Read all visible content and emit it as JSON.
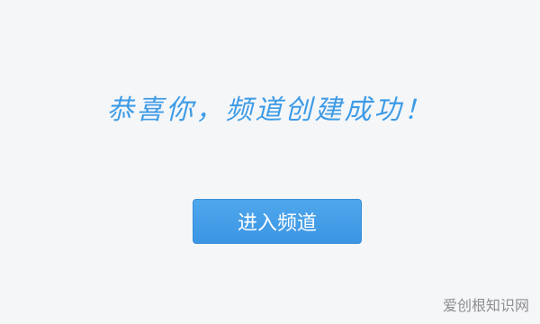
{
  "message": {
    "text": "恭喜你，频道创建成功！"
  },
  "actions": {
    "enter_label": "进入频道"
  },
  "watermark": {
    "text": "爱创根知识网"
  },
  "colors": {
    "accent": "#3d9be6",
    "button": "#3c95e4",
    "background": "#f5f6f8"
  }
}
